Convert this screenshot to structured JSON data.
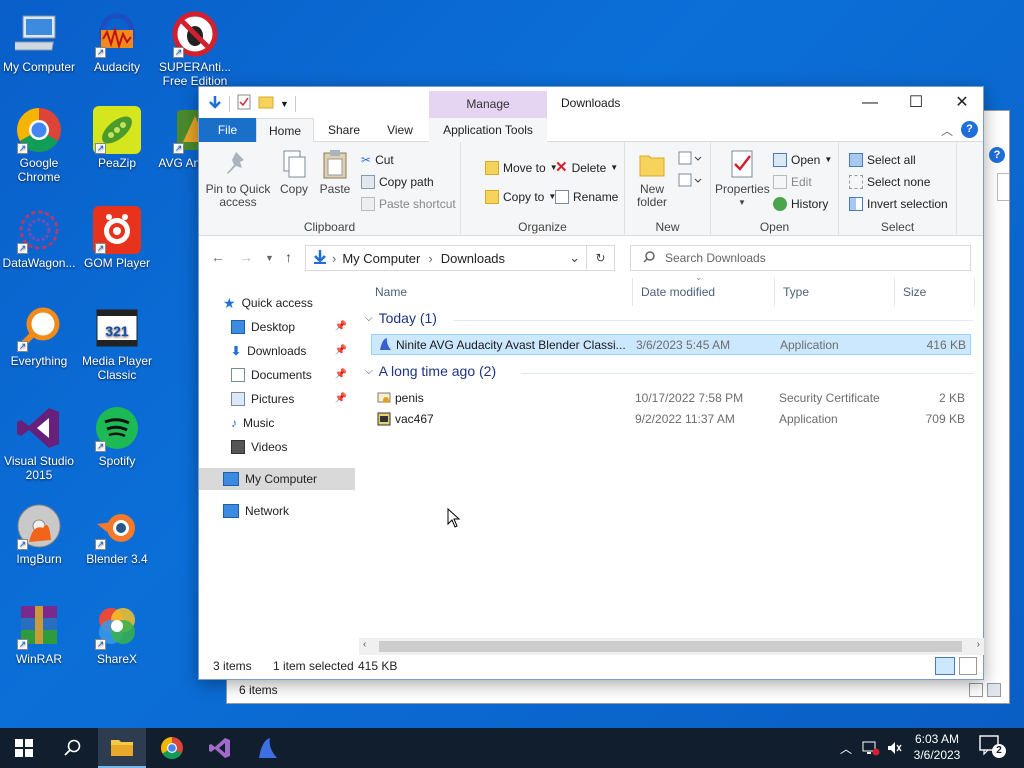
{
  "desktop": {
    "icons": [
      {
        "label": "My Computer"
      },
      {
        "label": "Audacity"
      },
      {
        "label": "SUPERAnti... Free Edition"
      },
      {
        "label": "Google Chrome"
      },
      {
        "label": "PeaZip"
      },
      {
        "label": "AVG An... Fre"
      },
      {
        "label": "DataWagon..."
      },
      {
        "label": "GOM Player"
      },
      {
        "label": "Everything"
      },
      {
        "label": "Media Player Classic"
      },
      {
        "label": "Visual Studio 2015"
      },
      {
        "label": "Spotify"
      },
      {
        "label": "ImgBurn"
      },
      {
        "label": "Blender 3.4"
      },
      {
        "label": "WinRAR"
      },
      {
        "label": "ShareX"
      }
    ]
  },
  "back_window": {
    "status": "6 items",
    "help": "?"
  },
  "window": {
    "title": "Downloads",
    "manage_tab": "Manage",
    "tabs": {
      "file": "File",
      "home": "Home",
      "share": "Share",
      "view": "View",
      "app_tools": "Application Tools"
    },
    "ribbon": {
      "clipboard": {
        "label": "Clipboard",
        "pin": "Pin to Quick access",
        "copy": "Copy",
        "paste": "Paste",
        "cut": "Cut",
        "copy_path": "Copy path",
        "paste_shortcut": "Paste shortcut"
      },
      "organize": {
        "label": "Organize",
        "move_to": "Move to",
        "copy_to": "Copy to",
        "delete": "Delete",
        "rename": "Rename"
      },
      "new": {
        "label": "New",
        "new_folder": "New folder"
      },
      "open": {
        "label": "Open",
        "properties": "Properties",
        "open": "Open",
        "edit": "Edit",
        "history": "History"
      },
      "select": {
        "label": "Select",
        "select_all": "Select all",
        "select_none": "Select none",
        "invert": "Invert selection"
      }
    },
    "address": {
      "root": "My Computer",
      "current": "Downloads"
    },
    "search": {
      "placeholder": "Search Downloads"
    },
    "nav": {
      "quick_access": "Quick access",
      "desktop": "Desktop",
      "downloads": "Downloads",
      "documents": "Documents",
      "pictures": "Pictures",
      "music": "Music",
      "videos": "Videos",
      "my_computer": "My Computer",
      "network": "Network"
    },
    "columns": {
      "name": "Name",
      "date": "Date modified",
      "type": "Type",
      "size": "Size"
    },
    "groups": [
      {
        "title": "Today (1)",
        "files": [
          {
            "name": "Ninite AVG Audacity Avast Blender Classi...",
            "date": "3/6/2023 5:45 AM",
            "type": "Application",
            "size": "416 KB"
          }
        ]
      },
      {
        "title": "A long time ago (2)",
        "files": [
          {
            "name": "penis",
            "date": "10/17/2022 7:58 PM",
            "type": "Security Certificate",
            "size": "2 KB"
          },
          {
            "name": "vac467",
            "date": "9/2/2022 11:37 AM",
            "type": "Application",
            "size": "709 KB"
          }
        ]
      }
    ],
    "status": {
      "items": "3 items",
      "selected": "1 item selected",
      "size": "415 KB"
    }
  },
  "taskbar": {
    "time": "6:03 AM",
    "date": "3/6/2023",
    "notifications": "2"
  },
  "colors": {
    "accent": "#1a6fc9",
    "selection": "#cce8ff",
    "manage": "#e6d4f3",
    "desktop": "#0b6fd8"
  }
}
